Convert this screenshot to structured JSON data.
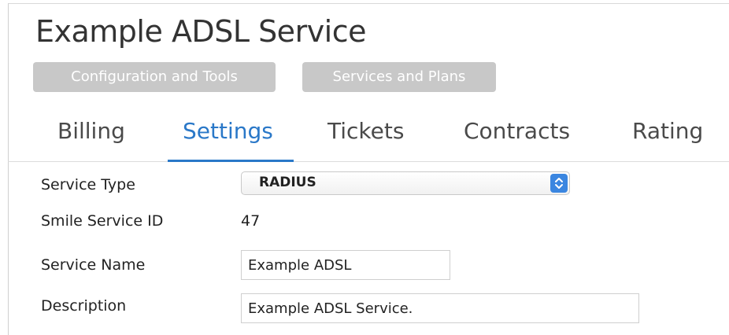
{
  "page": {
    "title": "Example ADSL Service"
  },
  "actions": {
    "config_label": "Configuration and Tools",
    "services_label": "Services and Plans"
  },
  "tabs": [
    {
      "label": "Billing",
      "active": false
    },
    {
      "label": "Settings",
      "active": true
    },
    {
      "label": "Tickets",
      "active": false
    },
    {
      "label": "Contracts",
      "active": false
    },
    {
      "label": "Rating",
      "active": false
    }
  ],
  "form": {
    "service_type": {
      "label": "Service Type",
      "value": "RADIUS"
    },
    "service_id": {
      "label": "Smile Service ID",
      "value": "47"
    },
    "service_name": {
      "label": "Service Name",
      "value": "Example ADSL"
    },
    "description": {
      "label": "Description",
      "value": "Example ADSL Service."
    }
  },
  "colors": {
    "accent": "#2a78c8",
    "pill_bg": "#c8c8c8",
    "select_button": "#3b86e0"
  },
  "icons": {
    "select_arrows": "up-down-chevron-icon"
  }
}
